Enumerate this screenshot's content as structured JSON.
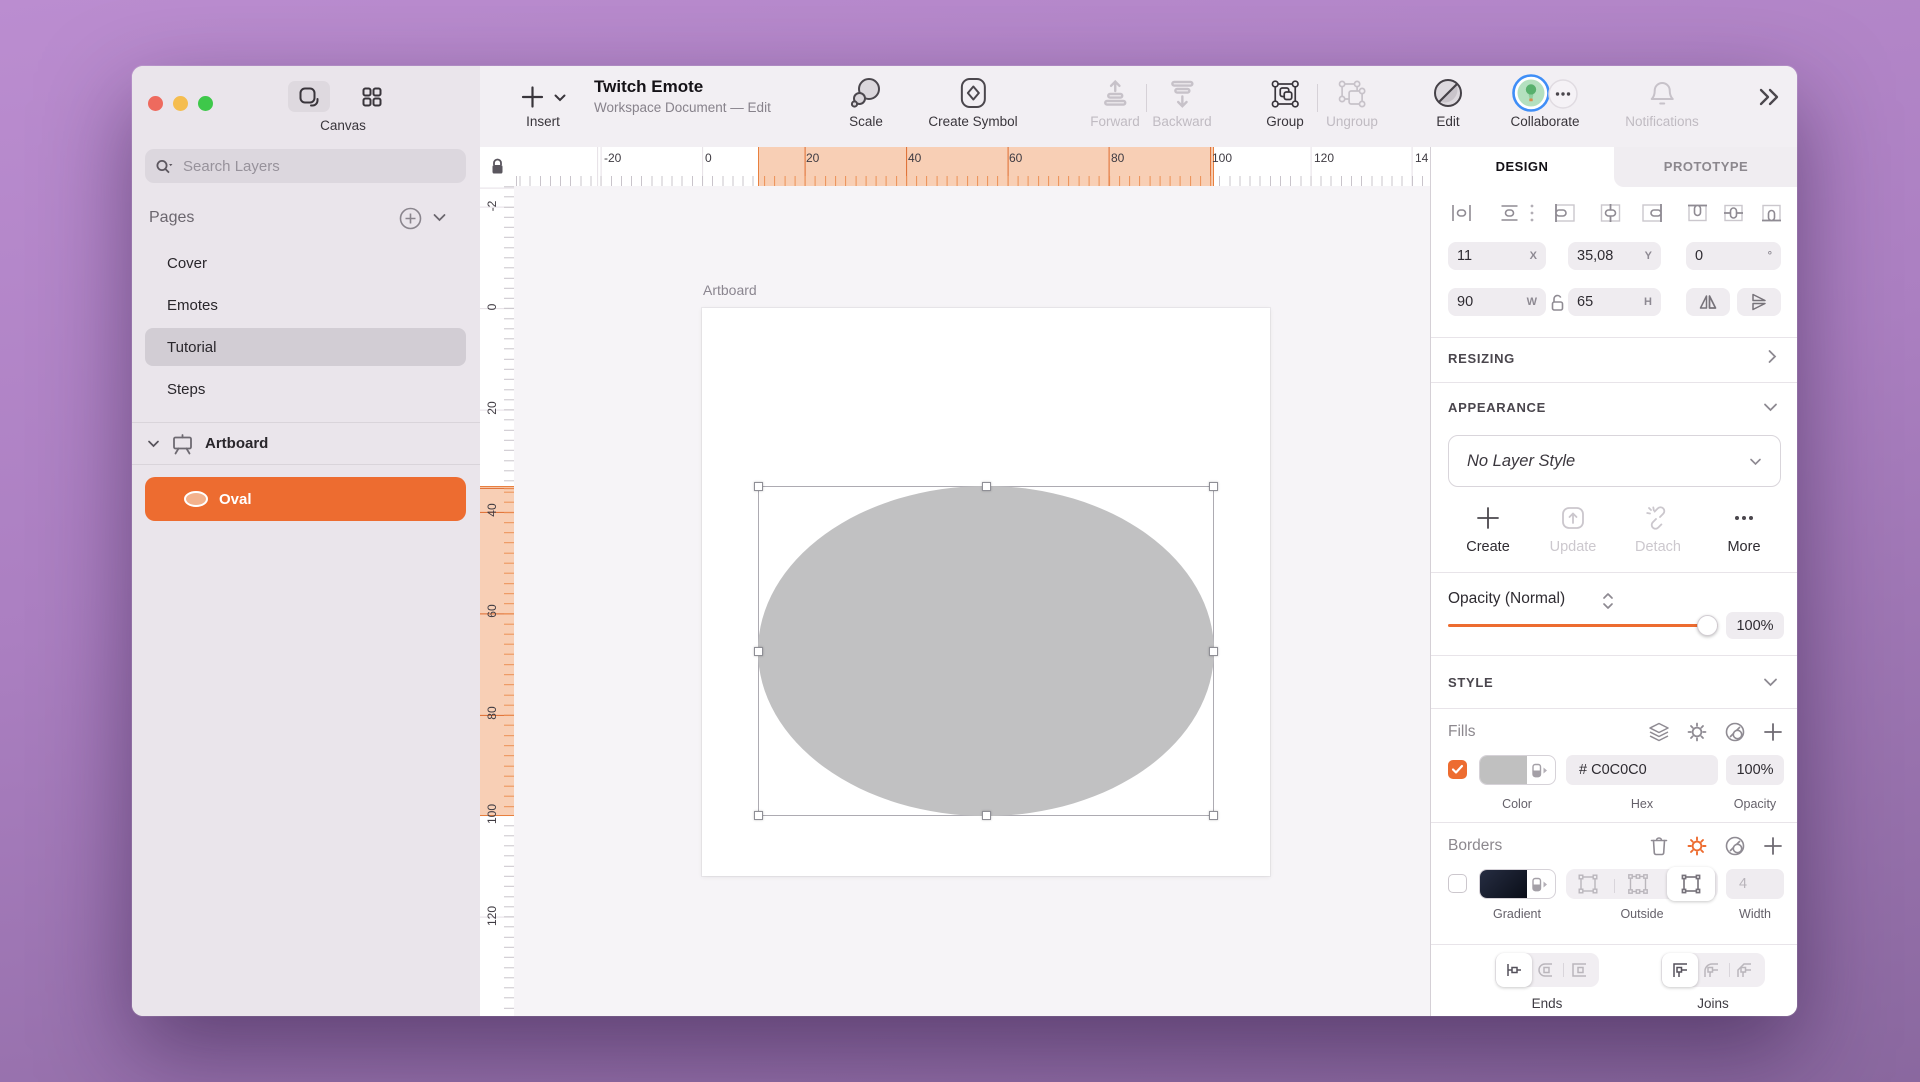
{
  "sidebar": {
    "view_label": "Canvas",
    "search_placeholder": "Search Layers",
    "pages_header": "Pages",
    "pages": [
      "Cover",
      "Emotes",
      "Tutorial",
      "Steps"
    ],
    "artboard_item": "Artboard",
    "oval_item": "Oval"
  },
  "toolbar": {
    "insert_label": "Insert",
    "doc_title": "Twitch Emote",
    "doc_subtitle": "Workspace Document — Edit",
    "scale_label": "Scale",
    "create_symbol_label": "Create Symbol",
    "forward_label": "Forward",
    "backward_label": "Backward",
    "group_label": "Group",
    "ungroup_label": "Ungroup",
    "edit_label": "Edit",
    "collaborate_label": "Collaborate",
    "notifications_label": "Notifications"
  },
  "rulers": {
    "h_labels": [
      "-20",
      "0",
      "20",
      "40",
      "60",
      "80",
      "100",
      "120",
      "14"
    ],
    "v_labels": [
      "-2",
      "0",
      "20",
      "40",
      "60",
      "80",
      "100",
      "120"
    ]
  },
  "canvas": {
    "artboard_name": "Artboard"
  },
  "inspector": {
    "tab_design": "DESIGN",
    "tab_prototype": "PROTOTYPE",
    "position": {
      "x": "11",
      "x_unit": "X",
      "y": "35,08",
      "y_unit": "Y",
      "rotation": "0",
      "rotation_unit": "°",
      "width": "90",
      "width_unit": "W",
      "height": "65",
      "height_unit": "H"
    },
    "resizing_header": "RESIZING",
    "appearance_header": "APPEARANCE",
    "layer_style_value": "No Layer Style",
    "actions": {
      "create": "Create",
      "update": "Update",
      "detach": "Detach",
      "more": "More"
    },
    "opacity_label": "Opacity (Normal)",
    "opacity_value": "100%",
    "style_header": "STYLE",
    "fills": {
      "header": "Fills",
      "hex_value": "# C0C0C0",
      "opacity_value": "100%",
      "color_label": "Color",
      "hex_label": "Hex",
      "opacity_label": "Opacity"
    },
    "borders": {
      "header": "Borders",
      "width_value": "4",
      "gradient_label": "Gradient",
      "position_label": "Outside",
      "width_label": "Width"
    },
    "ends_label": "Ends",
    "joins_label": "Joins"
  },
  "colors": {
    "accent": "#ED6C30",
    "fill_gray": "#C0C0C0",
    "ruler_highlight": "#F8CFB5",
    "border_swatch_dark": "#141A2A",
    "collaborate_ring": "#3F8EF7"
  }
}
